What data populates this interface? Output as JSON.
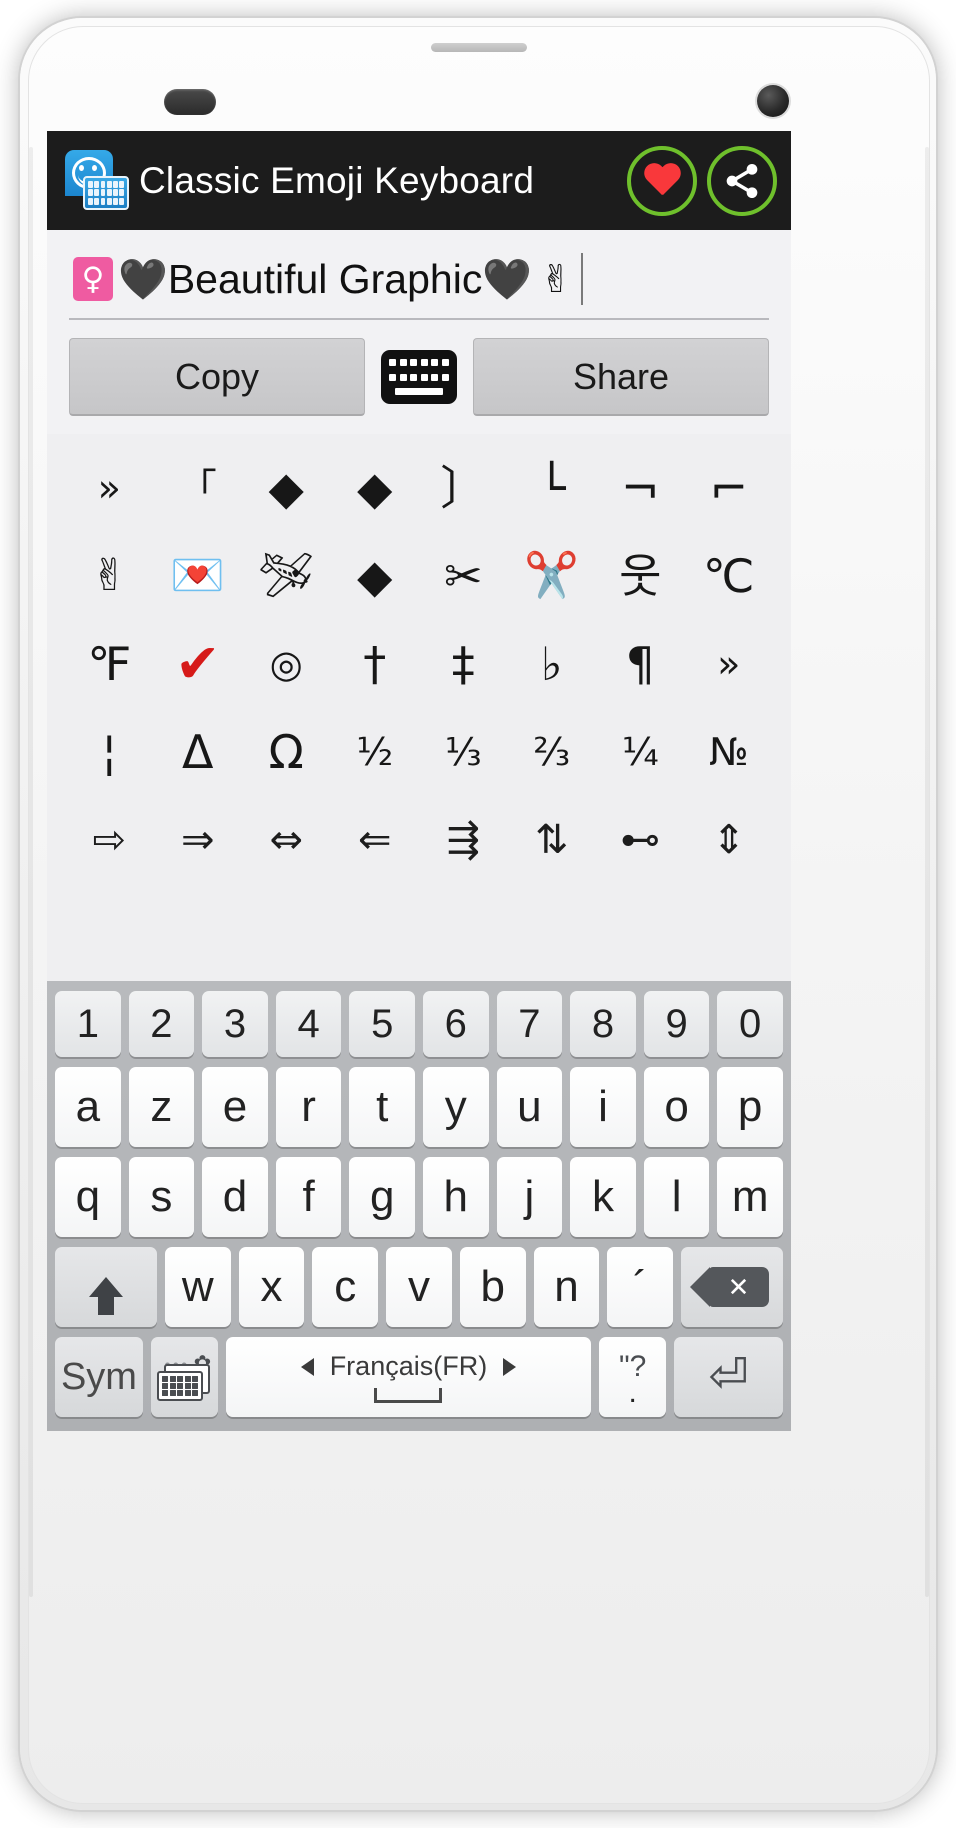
{
  "app": {
    "title": "Classic Emoji Keyboard",
    "logo_icon": "emoji-keyboard-logo-icon",
    "favorite_icon": "heart-icon",
    "share_icon": "share-icon"
  },
  "input": {
    "female_sign": "♀",
    "heart_left": "🖤",
    "text": "Beautiful Graphic",
    "heart_right": "🖤",
    "victory": "✌",
    "placeholder": ""
  },
  "toolbar": {
    "copy_label": "Copy",
    "keyboard_icon": "keyboard-icon",
    "share_label": "Share"
  },
  "symbol_grid": {
    "rows": [
      [
        {
          "g": "»",
          "name": "double-right-angle-quote"
        },
        {
          "g": "「",
          "name": "corner-bracket-left"
        },
        {
          "g": "◆",
          "name": "unknown-glyph-1"
        },
        {
          "g": "◆",
          "name": "unknown-glyph-2"
        },
        {
          "g": "〕",
          "name": "tortoise-bracket-right"
        },
        {
          "g": "└",
          "name": "box-corner-up-right"
        },
        {
          "g": "¬",
          "name": "not-sign"
        },
        {
          "g": "⌐",
          "name": "reversed-not-sign"
        }
      ],
      [
        {
          "g": "✌",
          "name": "victory-hand-emoji"
        },
        {
          "g": "💌",
          "name": "love-letter-emoji"
        },
        {
          "g": "🛩",
          "name": "airplane-emoji"
        },
        {
          "g": "◆",
          "name": "unknown-glyph-3"
        },
        {
          "g": "✂",
          "name": "scissors-black"
        },
        {
          "g": "✂️",
          "name": "scissors-emoji"
        },
        {
          "g": "웃",
          "name": "hangul-person"
        },
        {
          "g": "℃",
          "name": "degree-celsius"
        }
      ],
      [
        {
          "g": "℉",
          "name": "degree-fahrenheit"
        },
        {
          "g": "✔",
          "name": "check-mark-red"
        },
        {
          "g": "◎",
          "name": "bullseye"
        },
        {
          "g": "†",
          "name": "dagger"
        },
        {
          "g": "‡",
          "name": "double-dagger"
        },
        {
          "g": "♭",
          "name": "music-flat"
        },
        {
          "g": "¶",
          "name": "pilcrow"
        },
        {
          "g": "»",
          "name": "double-right-angle-quote-2"
        }
      ],
      [
        {
          "g": "¦",
          "name": "broken-bar"
        },
        {
          "g": "Δ",
          "name": "greek-delta"
        },
        {
          "g": "Ω",
          "name": "greek-omega"
        },
        {
          "g": "½",
          "name": "one-half"
        },
        {
          "g": "⅓",
          "name": "one-third"
        },
        {
          "g": "⅔",
          "name": "two-thirds"
        },
        {
          "g": "¼",
          "name": "one-quarter"
        },
        {
          "g": "№",
          "name": "numero-sign"
        }
      ],
      [
        {
          "g": "⇨",
          "name": "arrow-right-outline"
        },
        {
          "g": "⇒",
          "name": "arrow-right-double"
        },
        {
          "g": "⇔",
          "name": "arrow-left-right-double"
        },
        {
          "g": "⇐",
          "name": "arrow-left-double"
        },
        {
          "g": "⇶",
          "name": "arrow-triple-right"
        },
        {
          "g": "⇅",
          "name": "arrow-up-down-pair"
        },
        {
          "g": "⊷",
          "name": "arrow-bar-right"
        },
        {
          "g": "⇕",
          "name": "arrow-up-down-double"
        }
      ]
    ]
  },
  "keyboard": {
    "row_numbers": [
      "1",
      "2",
      "3",
      "4",
      "5",
      "6",
      "7",
      "8",
      "9",
      "0"
    ],
    "row_top": [
      "a",
      "z",
      "e",
      "r",
      "t",
      "y",
      "u",
      "i",
      "o",
      "p"
    ],
    "row_home": [
      "q",
      "s",
      "d",
      "f",
      "g",
      "h",
      "j",
      "k",
      "l",
      "m"
    ],
    "row_bottom": [
      "w",
      "x",
      "c",
      "v",
      "b",
      "n",
      "´"
    ],
    "shift_icon": "shift-up-arrow-icon",
    "backspace_icon": "backspace-icon",
    "sym_label": "Sym",
    "settings_icon": "keyboard-settings-icon",
    "language": "Français(FR)",
    "prev_lang_icon": "triangle-left-icon",
    "next_lang_icon": "triangle-right-icon",
    "space_icon": "space-bar-icon",
    "punct_top": "\"?",
    "punct_bottom": ".",
    "enter_icon": "enter-return-icon"
  },
  "colors": {
    "appbar_bg": "#1c1c1c",
    "accent_green": "#6fc02c",
    "heart_red": "#f9383b",
    "screen_bg": "#efeff1",
    "keyboard_bg": "#b8babd"
  }
}
